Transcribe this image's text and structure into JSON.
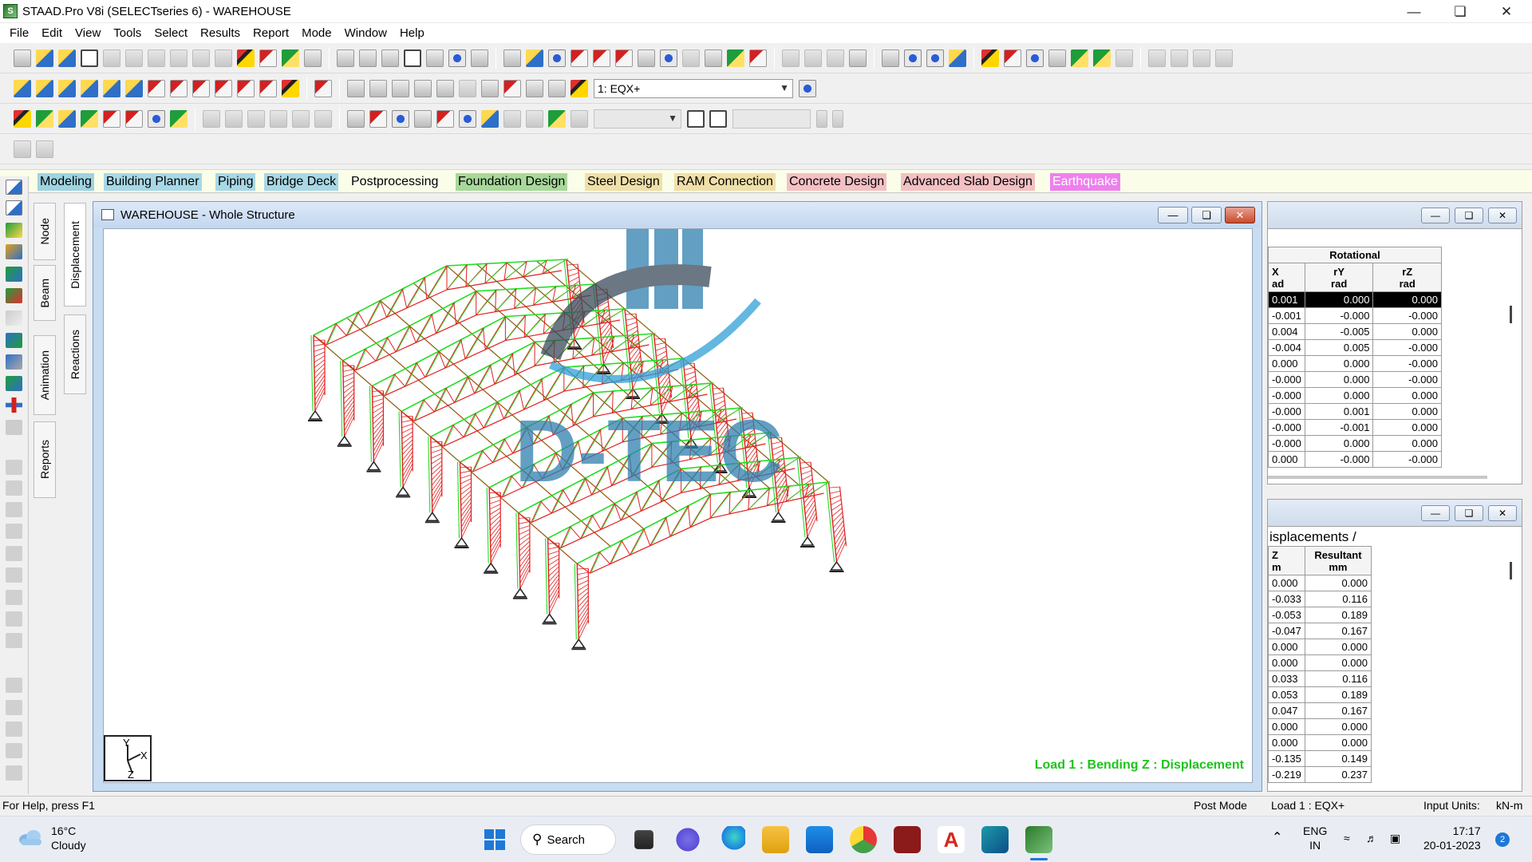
{
  "window": {
    "title": "STAAD.Pro V8i (SELECTseries 6) - WAREHOUSE",
    "app_icon": "staad-app-icon"
  },
  "menu": [
    "File",
    "Edit",
    "View",
    "Tools",
    "Select",
    "Results",
    "Report",
    "Mode",
    "Window",
    "Help"
  ],
  "toolbar": {
    "load_case_select": "1: EQX+",
    "secondary_select": "",
    "scale_field": ""
  },
  "page_tabs": [
    "Modeling",
    "Building Planner",
    "Piping",
    "Bridge Deck",
    "Postprocessing",
    "Foundation Design",
    "Steel Design",
    "RAM Connection",
    "Concrete Design",
    "Advanced Slab Design",
    "Earthquake"
  ],
  "side_tabs": [
    "Node",
    "Beam",
    "Animation",
    "Reports",
    "Displacement",
    "Reactions"
  ],
  "view_window": {
    "title": "WAREHOUSE - Whole Structure",
    "load_caption": "Load 1 : Bending Z : Displacement",
    "axis_labels": [
      "Y",
      "X",
      "Z"
    ],
    "watermark": "D-TEC"
  },
  "rotation_table": {
    "group_header": "Rotational",
    "columns": [
      {
        "name": "X",
        "unit": "ad"
      },
      {
        "name": "rY",
        "unit": "rad"
      },
      {
        "name": "rZ",
        "unit": "rad"
      }
    ],
    "rows": [
      [
        "0.001",
        "0.000",
        "0.000"
      ],
      [
        "-0.001",
        "-0.000",
        "-0.000"
      ],
      [
        "0.004",
        "-0.005",
        "0.000"
      ],
      [
        "-0.004",
        "0.005",
        "-0.000"
      ],
      [
        "0.000",
        "0.000",
        "-0.000"
      ],
      [
        "-0.000",
        "0.000",
        "-0.000"
      ],
      [
        "-0.000",
        "0.000",
        "0.000"
      ],
      [
        "-0.000",
        "0.001",
        "0.000"
      ],
      [
        "-0.000",
        "-0.001",
        "0.000"
      ],
      [
        "-0.000",
        "0.000",
        "0.000"
      ],
      [
        "0.000",
        "-0.000",
        "-0.000"
      ]
    ]
  },
  "displacement_table": {
    "sheet_tab": "isplacements",
    "columns": [
      {
        "name": "Z",
        "unit": "m"
      },
      {
        "name": "Resultant",
        "unit": "mm"
      }
    ],
    "rows": [
      [
        "0.000",
        "0.000"
      ],
      [
        "-0.033",
        "0.116"
      ],
      [
        "-0.053",
        "0.189"
      ],
      [
        "-0.047",
        "0.167"
      ],
      [
        "0.000",
        "0.000"
      ],
      [
        "0.000",
        "0.000"
      ],
      [
        "0.033",
        "0.116"
      ],
      [
        "0.053",
        "0.189"
      ],
      [
        "0.047",
        "0.167"
      ],
      [
        "0.000",
        "0.000"
      ],
      [
        "0.000",
        "0.000"
      ],
      [
        "-0.135",
        "0.149"
      ],
      [
        "-0.219",
        "0.237"
      ]
    ]
  },
  "status": {
    "help": "For Help, press F1",
    "mode": "Post Mode",
    "load": "Load 1 : EQX+",
    "units": "Input Units:",
    "units_value": "kN-m"
  },
  "taskbar": {
    "weather_temp": "16°C",
    "weather_desc": "Cloudy",
    "search_label": "Search",
    "lang_1": "ENG",
    "lang_2": "IN",
    "time": "17:17",
    "date": "20-01-2023",
    "notifications": "2"
  },
  "colors": {
    "members": "#e02020",
    "deformed": "#22dd22",
    "caption": "#1ec41e",
    "watermark": "#2f7fb0"
  }
}
